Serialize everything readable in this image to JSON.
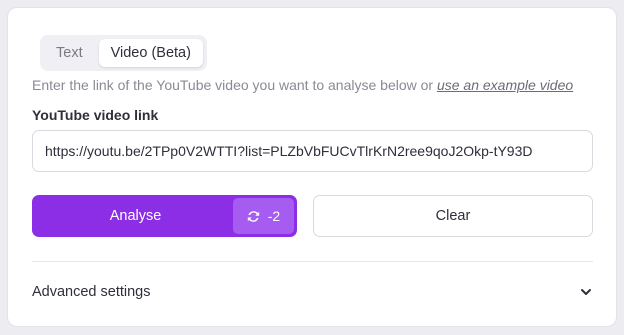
{
  "tabs": [
    {
      "label": "Text",
      "active": false
    },
    {
      "label": "Video (Beta)",
      "active": true
    }
  ],
  "hint": {
    "text": "Enter the link of the YouTube video you want to analyse below or ",
    "link_text": "use an example video"
  },
  "url_field": {
    "label": "YouTube video link",
    "value": "https://youtu.be/2TPp0V2WTTI?list=PLZbVbFUCvTlrKrN2ree9qoJ2Okp-tY93D"
  },
  "analyse_button": {
    "label": "Analyse",
    "credit_icon": "refresh-credit-icon",
    "credit_cost": "-2"
  },
  "clear_button": {
    "label": "Clear"
  },
  "advanced": {
    "label": "Advanced settings",
    "icon": "chevron-down-icon"
  },
  "colors": {
    "accent": "#8b2ee6",
    "badge": "#a65cf0"
  }
}
